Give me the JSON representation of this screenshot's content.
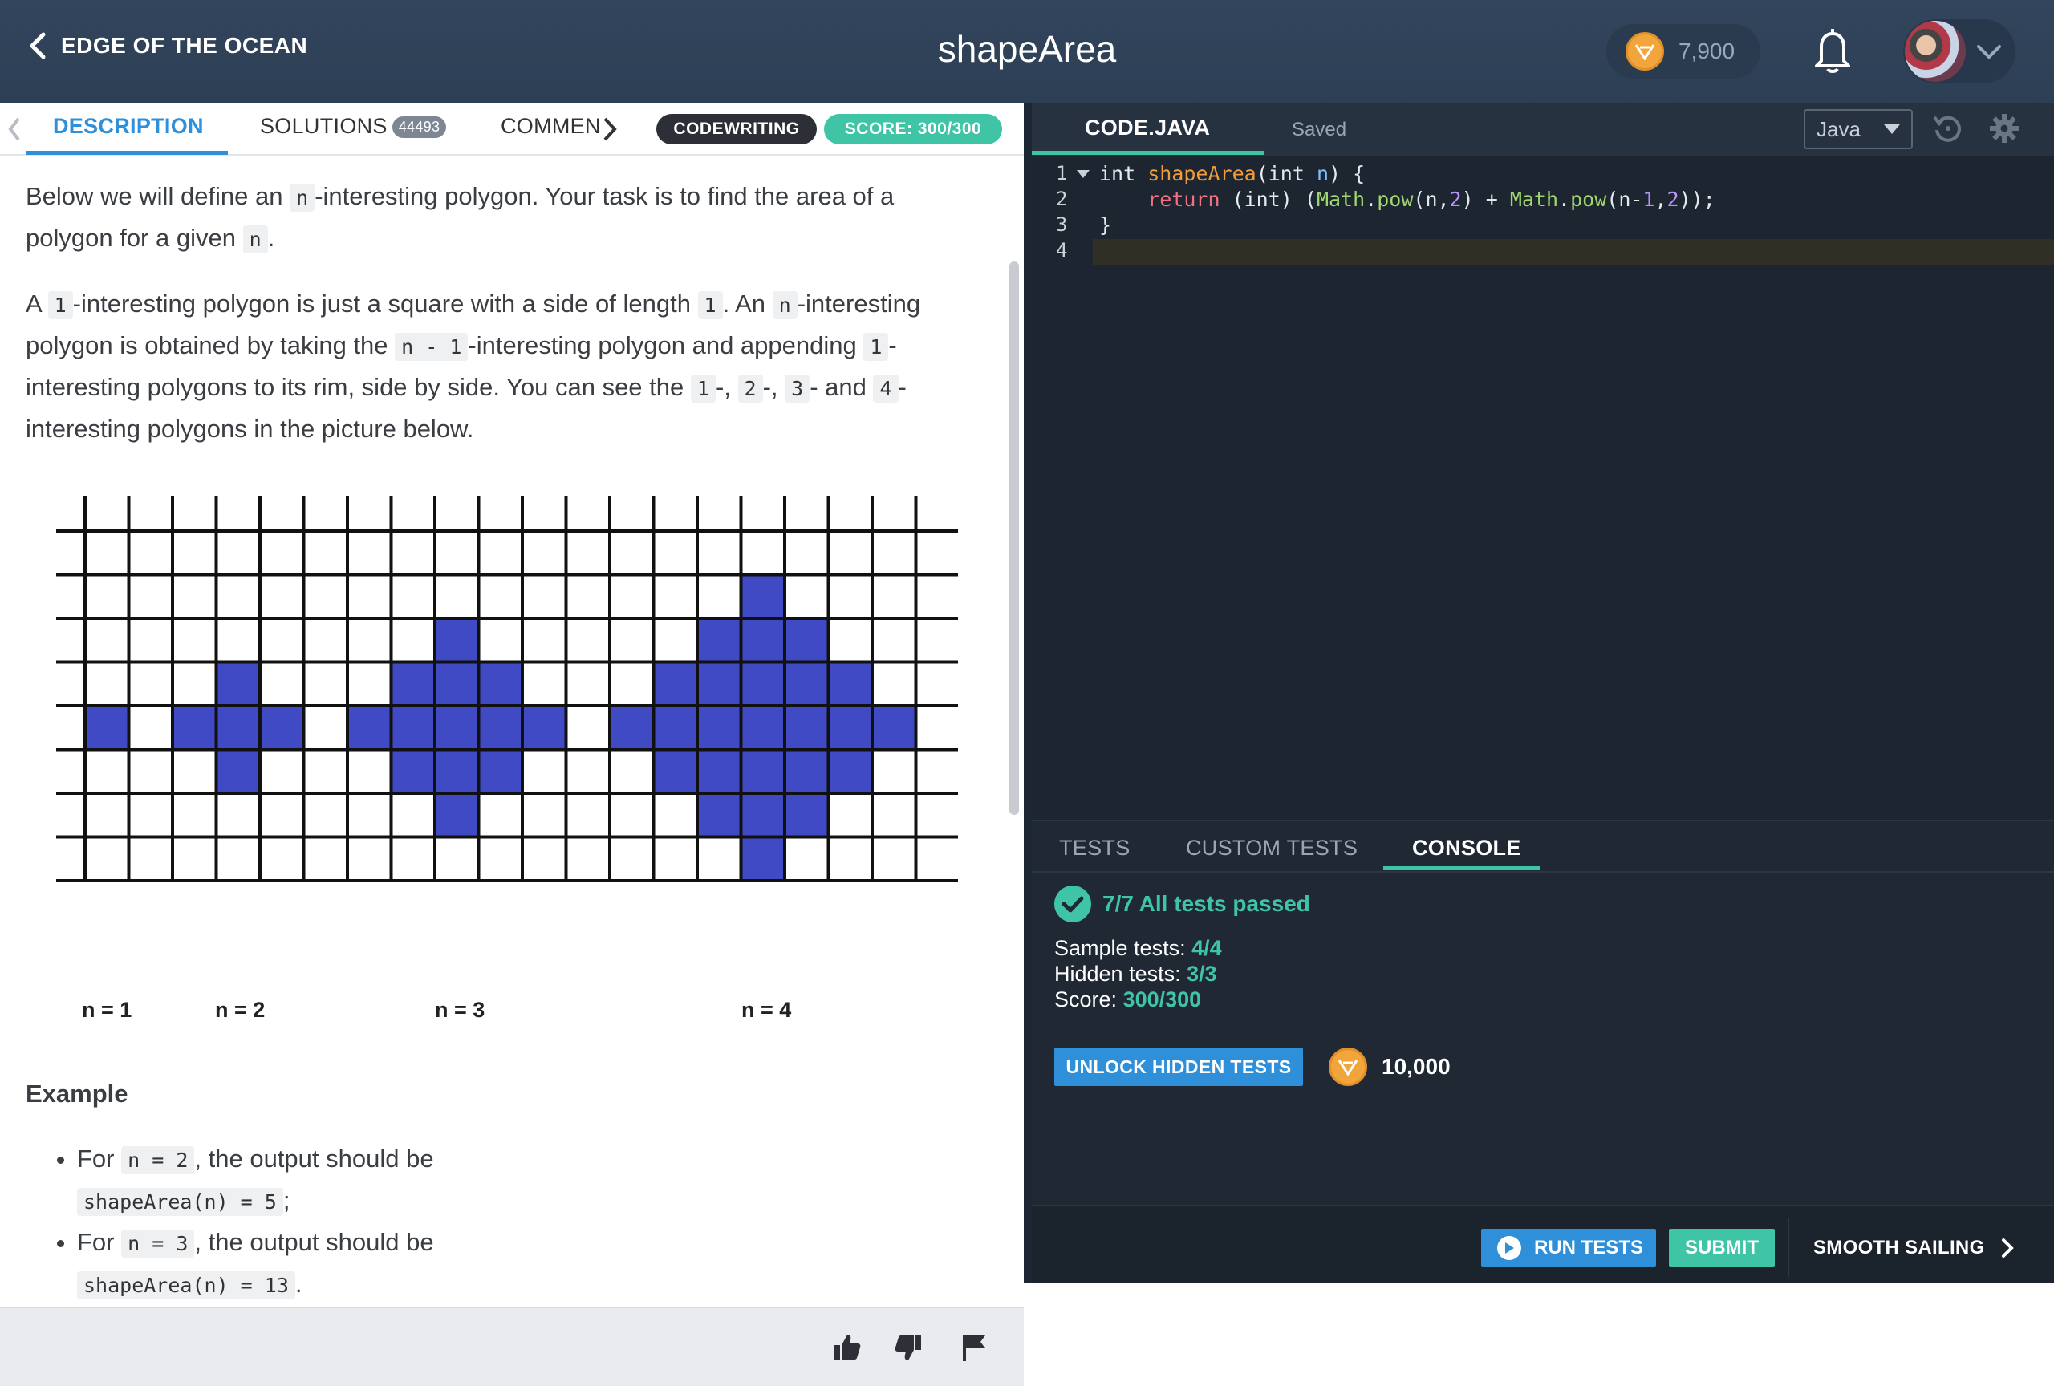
{
  "header": {
    "back_label": "EDGE OF THE OCEAN",
    "title": "shapeArea",
    "coins": "7,900"
  },
  "left_tabs": {
    "description": "DESCRIPTION",
    "solutions": "SOLUTIONS",
    "solutions_count": "44493",
    "comments": "COMMEN",
    "mode_badge": "CODEWRITING",
    "score_badge": "SCORE: 300/300"
  },
  "description": {
    "p1": [
      "Below we will define an ",
      "n",
      "-interesting polygon. Your task is to find the area of a polygon for a given ",
      "n",
      "."
    ],
    "p2": [
      "A ",
      "1",
      "-interesting polygon is just a square with a side of length ",
      "1",
      ". An ",
      "n",
      "-interesting polygon is obtained by taking the ",
      "n - 1",
      "-interesting polygon and appending ",
      "1",
      "-interesting polygons to its rim, side by side. You can see the ",
      "1",
      "-, ",
      "2",
      "-, ",
      "3",
      "- and ",
      "4",
      "-interesting polygons in the picture below."
    ],
    "figure_labels": [
      "n = 1",
      "n = 2",
      "n = 3",
      "n = 4"
    ],
    "example_heading": "Example",
    "examples": [
      {
        "pre": "For ",
        "input": "n = 2",
        "mid": ", the output should be",
        "output": "shapeArea(n) = 5",
        "end": ";"
      },
      {
        "pre": "For ",
        "input": "n = 3",
        "mid": ", the output should be",
        "output": "shapeArea(n) = 13",
        "end": "."
      }
    ]
  },
  "editor": {
    "file_tab": "CODE.JAVA",
    "status": "Saved",
    "language": "Java",
    "line_numbers": [
      "1",
      "2",
      "3",
      "4"
    ],
    "code_lines": [
      [
        [
          "plain",
          "int "
        ],
        [
          "fn",
          "shapeArea"
        ],
        [
          "plain",
          "(int "
        ],
        [
          "var",
          "n"
        ],
        [
          "plain",
          ") {"
        ]
      ],
      [
        [
          "plain",
          "    "
        ],
        [
          "kw",
          "return"
        ],
        [
          "plain",
          " (int) ("
        ],
        [
          "cls",
          "Math"
        ],
        [
          "plain",
          "."
        ],
        [
          "cls",
          "pow"
        ],
        [
          "plain",
          "(n,"
        ],
        [
          "num",
          "2"
        ],
        [
          "plain",
          ") + "
        ],
        [
          "cls",
          "Math"
        ],
        [
          "plain",
          "."
        ],
        [
          "cls",
          "pow"
        ],
        [
          "plain",
          "(n-"
        ],
        [
          "num",
          "1"
        ],
        [
          "plain",
          ","
        ],
        [
          "num",
          "2"
        ],
        [
          "plain",
          "));"
        ]
      ],
      [
        [
          "plain",
          "}"
        ]
      ],
      []
    ]
  },
  "console": {
    "tabs": [
      "TESTS",
      "CUSTOM TESTS",
      "CONSOLE"
    ],
    "result": "7/7 All tests passed",
    "sample_label": "Sample tests: ",
    "sample_value": "4/4",
    "hidden_label": "Hidden tests: ",
    "hidden_value": "3/3",
    "score_label": "Score: ",
    "score_value": "300/300",
    "unlock_label": "UNLOCK HIDDEN TESTS",
    "unlock_cost": "10,000"
  },
  "actions": {
    "run_tests": "RUN TESTS",
    "submit": "SUBMIT",
    "next": "SMOOTH SAILING"
  },
  "colors": {
    "accent_blue": "#2f8fd8",
    "accent_green": "#3fc5a6",
    "polygon_fill": "#3f4ac4"
  }
}
